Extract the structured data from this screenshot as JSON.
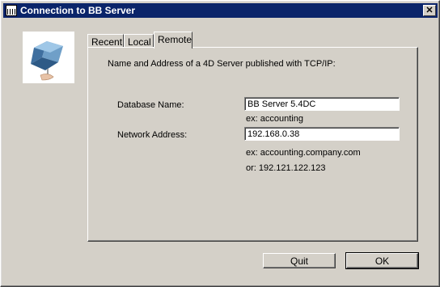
{
  "window": {
    "title": "Connection to BB Server",
    "close_glyph": "✕",
    "icons": {
      "app": "app-window-icon",
      "logo": "cube-server-logo-icon",
      "close": "close-icon"
    }
  },
  "tabs": [
    {
      "label": "Recent",
      "active": false
    },
    {
      "label": "Local",
      "active": false
    },
    {
      "label": "Remote",
      "active": true
    }
  ],
  "remote": {
    "intro": "Name and Address of a 4D Server published with TCP/IP:",
    "database_label": "Database Name:",
    "database_value": "BB Server 5.4DC",
    "database_hint": "ex: accounting",
    "address_label": "Network Address:",
    "address_value": "192.168.0.38",
    "address_hint1": "ex: accounting.company.com",
    "address_hint2": "or: 192.121.122.123"
  },
  "buttons": {
    "quit": "Quit",
    "ok": "OK"
  },
  "colors": {
    "titlebar": "#0a246a",
    "face": "#d4d0c8"
  }
}
